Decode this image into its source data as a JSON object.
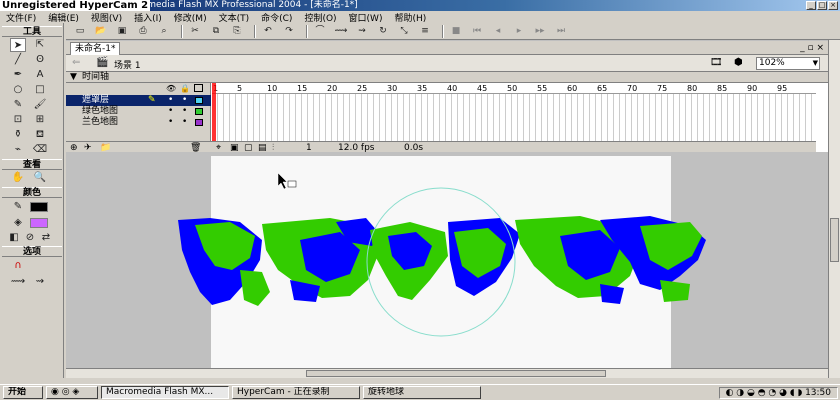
{
  "window": {
    "hypercam_label": "Unregistered HyperCam 2",
    "title": "Macromedia Flash MX Professional 2004 - [未命名-1*]"
  },
  "menu": [
    "文件(F)",
    "编辑(E)",
    "视图(V)",
    "插入(I)",
    "修改(M)",
    "文本(T)",
    "命令(C)",
    "控制(O)",
    "窗口(W)",
    "帮助(H)"
  ],
  "tools_panel": {
    "tools_header": "工具",
    "view_header": "查看",
    "colors_header": "颜色",
    "options_header": "选项"
  },
  "document": {
    "tab_label": "未命名-1*",
    "scene_label": "场景 1",
    "zoom": "102%"
  },
  "timeline": {
    "header": "时间轴",
    "frame_numbers": [
      "1",
      "5",
      "10",
      "15",
      "20",
      "25",
      "30",
      "35",
      "40",
      "45",
      "50",
      "55",
      "60",
      "65",
      "70",
      "75",
      "80",
      "85",
      "90",
      "95"
    ],
    "layers": [
      {
        "name": "遮罩层",
        "color": "#4fd2f2",
        "selected": true
      },
      {
        "name": "绿色地图",
        "color": "#33cc33",
        "selected": false
      },
      {
        "name": "兰色地图",
        "color": "#9933cc",
        "selected": false
      }
    ],
    "current_frame": "1",
    "frame_rate": "12.0 fps",
    "elapsed": "0.0s"
  },
  "taskbar": {
    "start": "开始",
    "tasks": [
      "Macromedia Flash MX...",
      "HyperCam - 正在录制",
      "旋转地球"
    ],
    "clock": "13:50"
  },
  "colors": {
    "map_blue": "#0000ff",
    "map_green": "#33cc00",
    "stage_bg": "#f8f8f8",
    "mask_circle": "#88ddcc"
  }
}
